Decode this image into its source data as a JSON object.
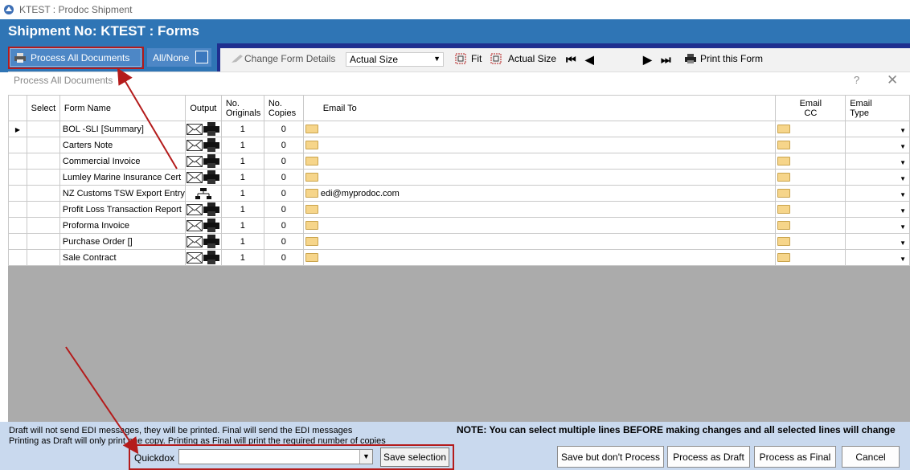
{
  "window": {
    "title": "KTEST : Prodoc Shipment"
  },
  "header": {
    "title": "Shipment No: KTEST : Forms"
  },
  "toolbar": {
    "process_all_label": "Process All Documents",
    "all_none_label": "All/None",
    "change_form_details": "Change Form Details",
    "zoom_value": "Actual Size",
    "fit_label": "Fit",
    "actual_size_label": "Actual Size",
    "print_label": "Print this Form"
  },
  "dialog": {
    "title": "Process All Documents",
    "help": "?",
    "close": "✕"
  },
  "grid": {
    "columns": {
      "select": "Select",
      "form_name": "Form Name",
      "output": "Output",
      "no_originals_1": "No.",
      "no_originals_2": "Originals",
      "no_copies_1": "No.",
      "no_copies_2": "Copies",
      "email_to": "Email To",
      "email_cc_1": "Email",
      "email_cc_2": "CC",
      "email_type_1": "Email",
      "email_type_2": "Type"
    },
    "rows": [
      {
        "name": "BOL -SLI [Summary]",
        "output": "email-print",
        "originals": "1",
        "copies": "0",
        "email": ""
      },
      {
        "name": "Carters Note",
        "output": "email-print",
        "originals": "1",
        "copies": "0",
        "email": ""
      },
      {
        "name": "Commercial Invoice",
        "output": "email-print",
        "originals": "1",
        "copies": "0",
        "email": ""
      },
      {
        "name": "Lumley Marine Insurance Cert",
        "output": "email-print",
        "originals": "1",
        "copies": "0",
        "email": ""
      },
      {
        "name": "NZ Customs TSW Export Entry",
        "output": "edi",
        "originals": "1",
        "copies": "0",
        "email": "edi@myprodoc.com"
      },
      {
        "name": "Profit Loss Transaction Report",
        "output": "email-print",
        "originals": "1",
        "copies": "0",
        "email": ""
      },
      {
        "name": "Proforma Invoice",
        "output": "email-print",
        "originals": "1",
        "copies": "0",
        "email": ""
      },
      {
        "name": "Purchase Order []",
        "output": "email-print",
        "originals": "1",
        "copies": "0",
        "email": ""
      },
      {
        "name": "Sale Contract",
        "output": "email-print",
        "originals": "1",
        "copies": "0",
        "email": ""
      }
    ]
  },
  "footer": {
    "note_line1": "Draft will not send EDI messages, they will be printed.  Final will send the EDI messages",
    "note_line2": "Printing as Draft will only print one copy.  Printing as Final will print the required number of copies",
    "note_big": "NOTE:  You can select multiple lines BEFORE making changes and all selected lines will change",
    "quickdox_label": "Quickdox",
    "quickdox_value": "",
    "save_selection": "Save selection",
    "save_no_process": "Save but don't Process",
    "process_draft": "Process as Draft",
    "process_final": "Process as Final",
    "cancel": "Cancel"
  },
  "colors": {
    "header": "#2f75b5",
    "toolbar_dark": "#1f2f8f",
    "footer": "#c9d9ee",
    "annotation": "#b41b1b"
  }
}
